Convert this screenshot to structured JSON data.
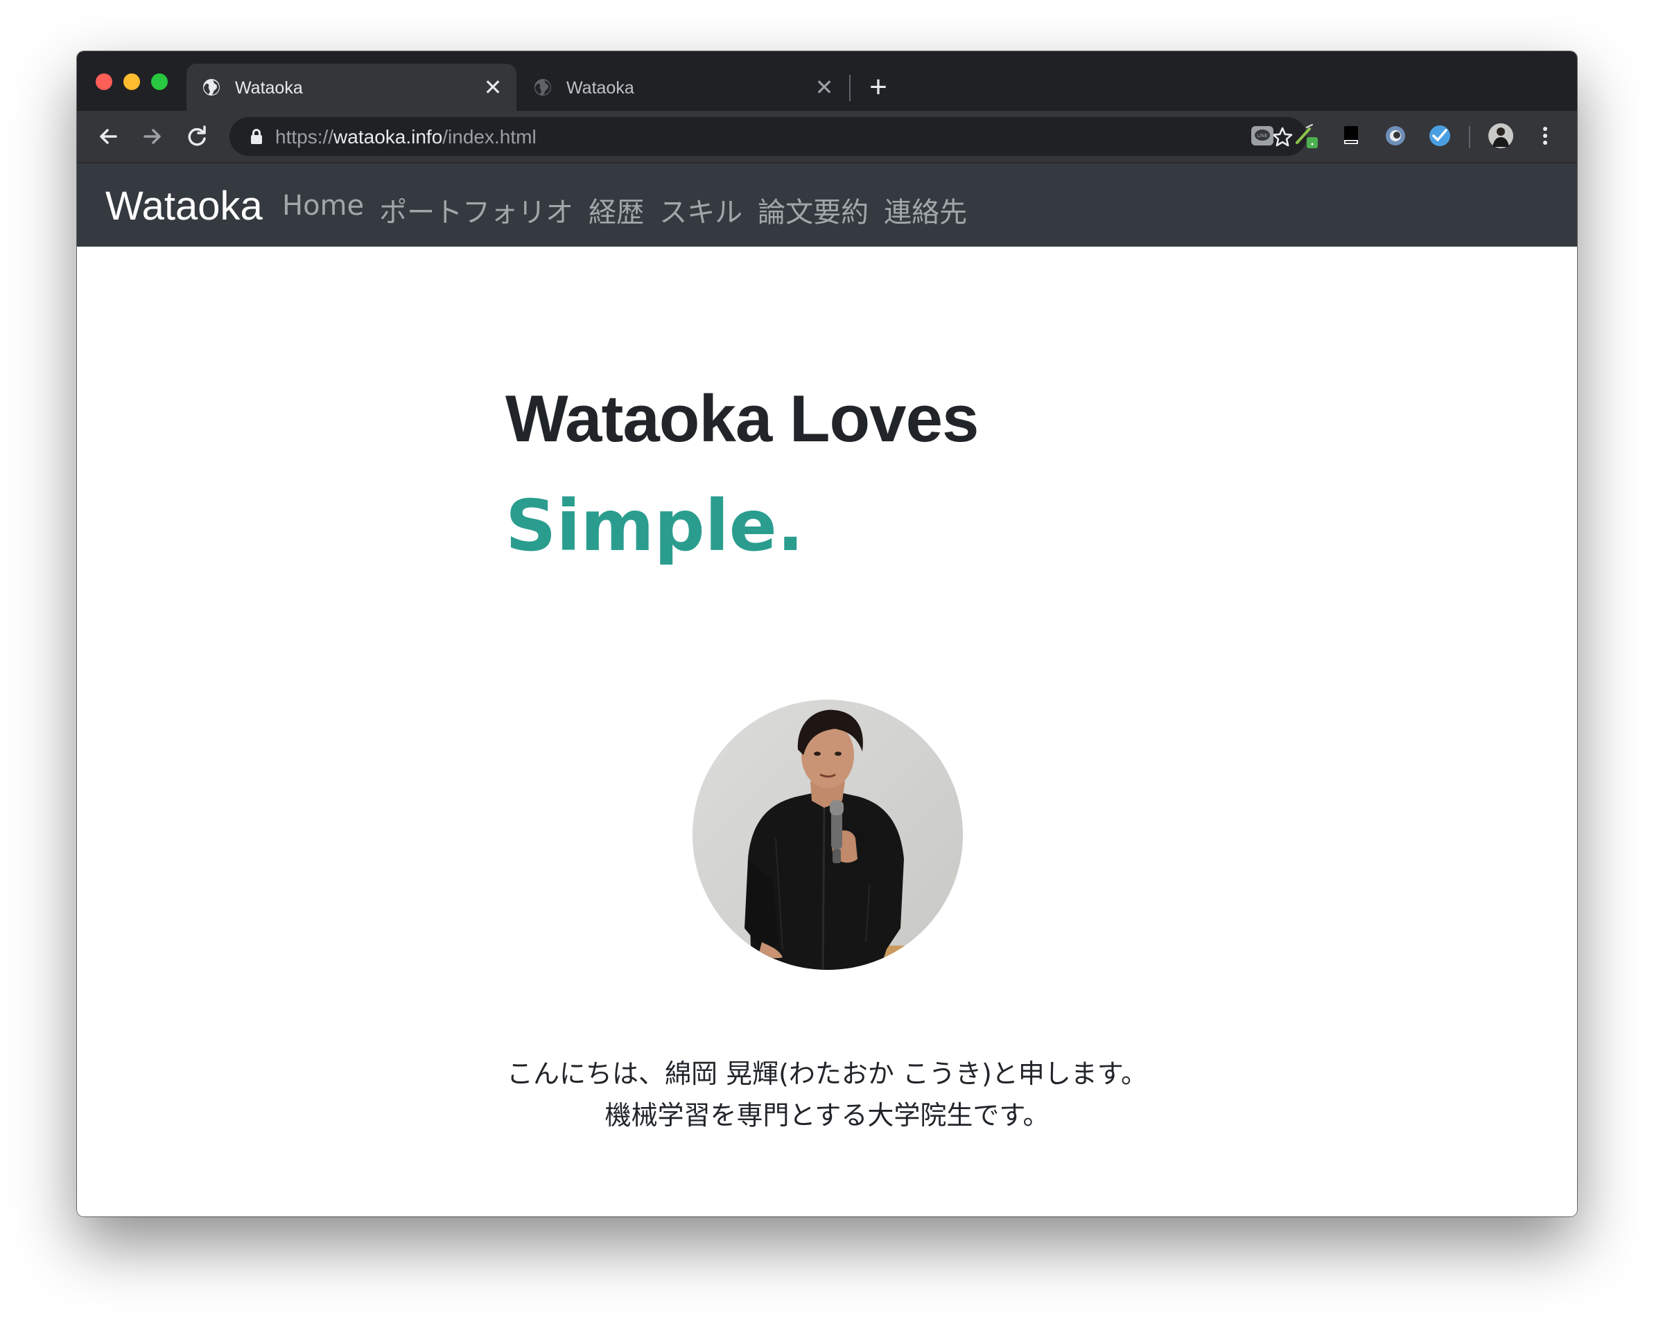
{
  "browser": {
    "tabs": [
      {
        "title": "Wataoka",
        "active": true
      },
      {
        "title": "Wataoka",
        "active": false
      }
    ],
    "close_glyph": "✕",
    "new_tab_glyph": "+",
    "url": {
      "scheme": "https://",
      "host": "wataoka.info",
      "path": "/index.html"
    },
    "extensions": [
      "line-icon",
      "pen-icon",
      "bookmark-icon",
      "circle-extension-icon",
      "check-extension-icon"
    ],
    "colors": {
      "tabstrip": "#202124",
      "toolbar": "#35363a",
      "omnibox": "#202124"
    }
  },
  "site": {
    "brand": "Wataoka",
    "nav": [
      "Home",
      "ポートフォリオ",
      "経歴",
      "スキル",
      "論文要約",
      "連絡先"
    ],
    "hero": {
      "line1": "Wataoka Loves",
      "line2": "Simple."
    },
    "intro": {
      "line1": "こんにちは、綿岡 晃輝(わたおか こうき)と申します。",
      "line2": "機械学習を専門とする大学院生です。"
    },
    "colors": {
      "navbar": "#343a40",
      "accent": "#2a9d8f",
      "text": "#212529"
    }
  }
}
